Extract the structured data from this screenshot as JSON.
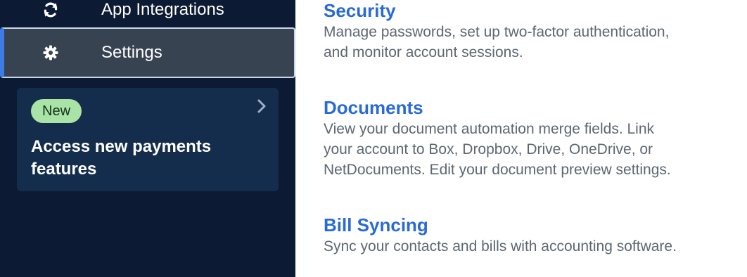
{
  "sidebar": {
    "items": [
      {
        "label": "App Integrations",
        "icon": "refresh-icon"
      },
      {
        "label": "Settings",
        "icon": "gear-icon",
        "active": true
      }
    ],
    "promo": {
      "badge": "New",
      "title": "Access new payments features",
      "icon": "chevron-right-icon"
    }
  },
  "main": {
    "sections": [
      {
        "title": "Security",
        "lines": [
          "Manage passwords, set up two-factor authentication,",
          "and monitor account sessions."
        ]
      },
      {
        "title": "Documents",
        "lines": [
          "View your document automation merge fields. Link",
          "your account to Box, Dropbox, Drive, OneDrive, or",
          "NetDocuments. Edit your document preview settings."
        ]
      },
      {
        "title": "Bill Syncing",
        "lines": [
          "Sync your contacts and bills with accounting software."
        ]
      }
    ]
  },
  "colors": {
    "sidebar_bg": "#0c1b33",
    "active_item_bg": "#384352",
    "active_accent": "#3d7be6",
    "promo_bg": "#152d4c",
    "badge_bg": "#a9e3a6",
    "link": "#2a6ad6",
    "body_text": "#5d6772"
  }
}
